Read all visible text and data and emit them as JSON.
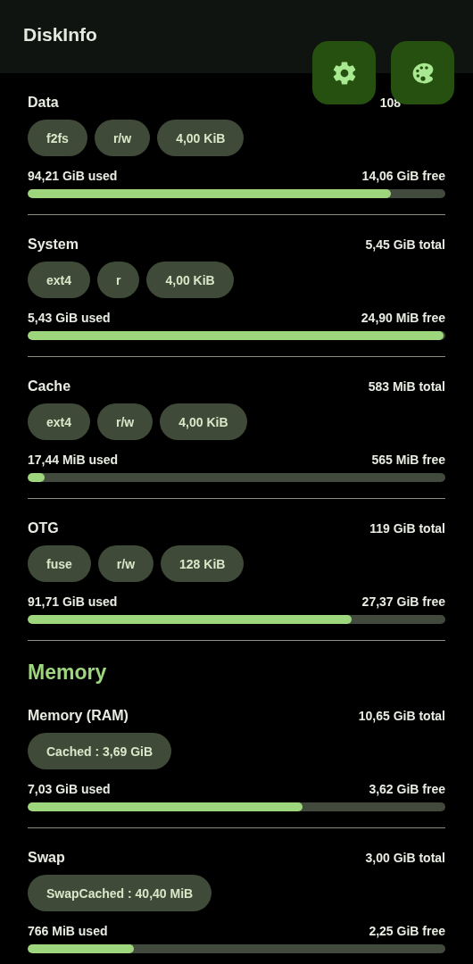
{
  "app_bar": {
    "title": "DiskInfo"
  },
  "actions": [
    {
      "kind": "settings"
    },
    {
      "kind": "palette"
    }
  ],
  "storage": [
    {
      "name": "Data",
      "total": "108",
      "chips": [
        "f2fs",
        "r/w",
        "4,00 KiB"
      ],
      "used": "94,21 GiB used",
      "free": "14,06 GiB free",
      "level": 0.87
    },
    {
      "name": "System",
      "total": "5,45 GiB total",
      "chips": [
        "ext4",
        "r",
        "4,00 KiB"
      ],
      "used": "5,43 GiB used",
      "free": "24,90 MiB free",
      "level": 0.995
    },
    {
      "name": "Cache",
      "total": "583 MiB total",
      "chips": [
        "ext4",
        "r/w",
        "4,00 KiB"
      ],
      "used": "17,44 MiB used",
      "free": "565 MiB free",
      "level": 0.04
    },
    {
      "name": "OTG",
      "total": "119 GiB total",
      "chips": [
        "fuse",
        "r/w",
        "128 KiB"
      ],
      "used": "91,71 GiB used",
      "free": "27,37 GiB free",
      "level": 0.775
    }
  ],
  "memory_heading": "Memory",
  "memory": [
    {
      "name": "Memory (RAM)",
      "total": "10,65 GiB total",
      "chips": [
        "Cached : 3,69 GiB"
      ],
      "used": "7,03 GiB used",
      "free": "3,62 GiB free",
      "level": 0.658
    },
    {
      "name": "Swap",
      "total": "3,00 GiB total",
      "chips": [
        "SwapCached : 40,40 MiB"
      ],
      "used": "766 MiB used",
      "free": "2,25 GiB free",
      "level": 0.255
    }
  ]
}
